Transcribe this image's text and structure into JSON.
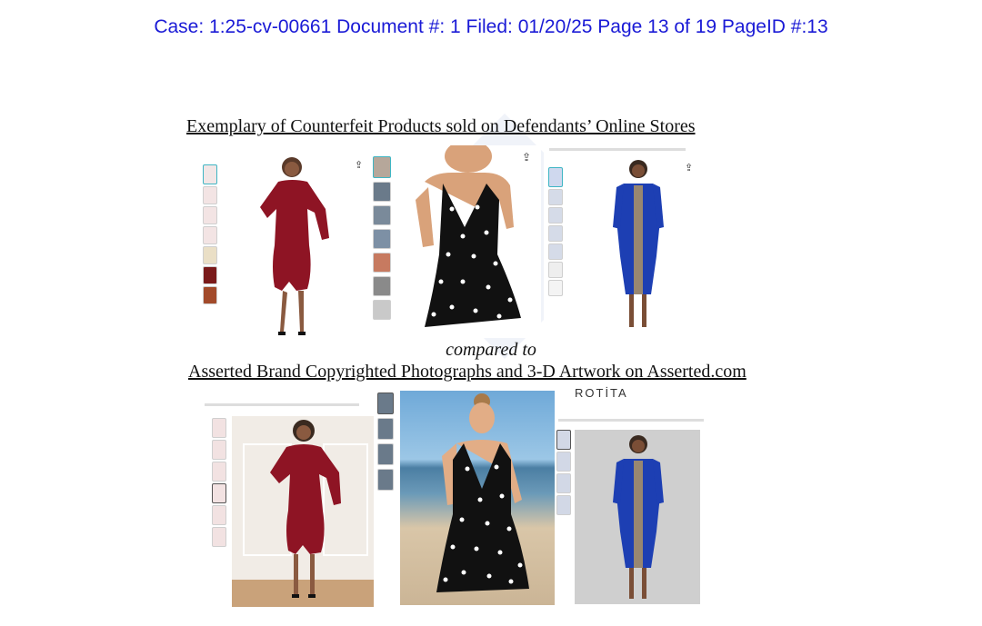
{
  "header": {
    "text": "Case: 1:25-cv-00661 Document #: 1 Filed: 01/20/25 Page 13 of 19 PageID #:13"
  },
  "section": {
    "title": "Exemplary of Counterfeit Products sold on Defendants’ Online Stores",
    "compared": "compared to",
    "subtitle": "Asserted Brand Copyrighted Photographs and 3-D Artwork on Asserted.com"
  },
  "brand_logo": {
    "text": "ROTİTA"
  },
  "colors": {
    "header": "#1a1ad6",
    "red_dress": "#8e1424",
    "blue_dress": "#1d3fb3",
    "polka_dress": "#111111"
  },
  "products": [
    {
      "name": "red off-shoulder ruched dress",
      "group": "counterfeit"
    },
    {
      "name": "black polka dot halter dress",
      "group": "counterfeit"
    },
    {
      "name": "blue printed sleeve dress",
      "group": "counterfeit"
    },
    {
      "name": "red off-shoulder ruched dress",
      "group": "asserted"
    },
    {
      "name": "black polka dot halter dress",
      "group": "asserted"
    },
    {
      "name": "blue printed sleeve dress",
      "group": "asserted"
    }
  ]
}
